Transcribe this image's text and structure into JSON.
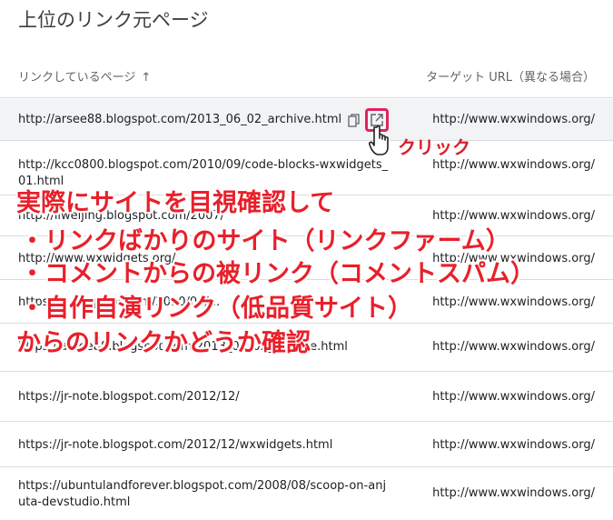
{
  "page": {
    "title": "上位のリンク元ページ"
  },
  "table": {
    "col_left": "リンクしているページ",
    "sort_icon": "arrow-up-icon",
    "col_right": "ターゲット URL（異なる場合）",
    "rows": [
      {
        "url": "http://arsee88.blogspot.com/2013_06_02_archive.html",
        "target": "http://www.wxwindows.org/"
      },
      {
        "url": "http://kcc0800.blogspot.com/2010/09/code-blocks-wxwidgets_01.html",
        "target": "http://www.wxwindows.org/"
      },
      {
        "url": "http://liweijing.blogspot.com/2007/",
        "target": "http://www.wxwindows.org/"
      },
      {
        "url": "http://www.wxwidgets.org/",
        "target": "http://www.wxwindows.org/"
      },
      {
        "url": "https://...blogspot.com/2010/04/...",
        "target": "http://www.wxwindows.org/"
      },
      {
        "url": "https://arsee88.blogspot.com/2013_06_02_archive.html",
        "target": "http://www.wxwindows.org/"
      },
      {
        "url": "https://jr-note.blogspot.com/2012/12/",
        "target": "http://www.wxwindows.org/"
      },
      {
        "url": "https://jr-note.blogspot.com/2012/12/wxwidgets.html",
        "target": "http://www.wxwindows.org/"
      },
      {
        "url": "https://ubuntulandforever.blogspot.com/2008/08/scoop-on-anjuta-devstudio.html",
        "target": "http://www.wxwindows.org/"
      }
    ]
  },
  "annotations": {
    "click_label": "クリック",
    "line1": "実際にサイトを目視確認して",
    "line2": "・リンクばかりのサイト（リンクファーム）",
    "line3": "・コメントからの被リンク（コメントスパム）",
    "line4": "・自作自演リンク（低品質サイト）",
    "line5": "からのリンクかどうか確認",
    "accent": "#e8202a",
    "highlight_box": "#e0245e"
  }
}
